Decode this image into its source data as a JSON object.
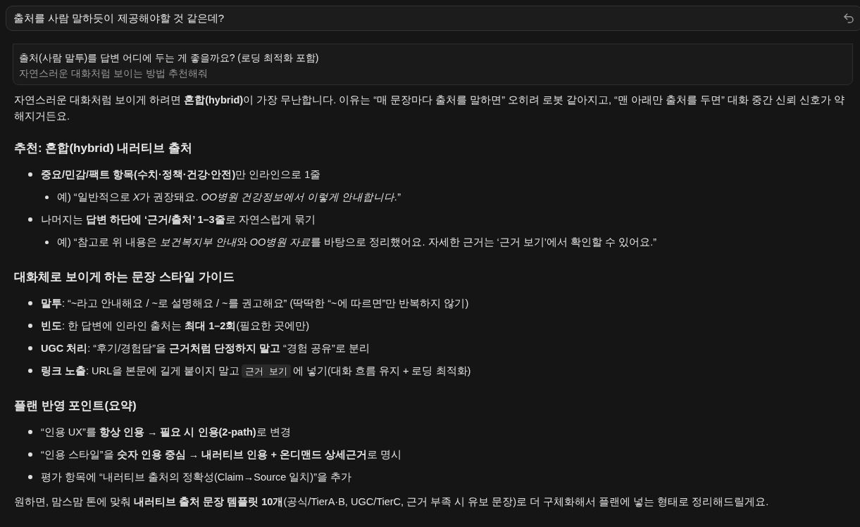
{
  "prompt_field": {
    "value": "출처를 사람 말하듯이 제공해야할 것 같은데?"
  },
  "answer_card": {
    "title": "출처(사람 말투)를 답변 어디에 두는 게 좋을까요? (로딩 최적화 포함)",
    "subtitle": "자연스러운 대화처럼 보이는 방법 추천해줘"
  },
  "intro": "자연스러운 대화처럼 보이게 하려면 **혼합(hybrid)**이 가장 무난합니다. 이유는 “매 문장마다 출처를 말하면” 오히려 로봇 같아지고, “맨 아래만 출처를 두면” 대화 중간 신뢰 신호가 약해지거든요.",
  "sections": [
    {
      "heading": "추천: 혼합(hybrid) 내러티브 출처",
      "items": [
        {
          "text": "**중요/민감/팩트 항목(수치·정책·건강·안전)**만 인라인으로 1줄",
          "children": [
            {
              "segments": [
                {
                  "kind": "text",
                  "text": "예) “일반적으로 "
                },
                {
                  "kind": "italic",
                  "text": "X"
                },
                {
                  "kind": "text",
                  "text": "가 권장돼요. *OO병원 건강정보에서 이렇게 안내합니다.*”"
                }
              ]
            }
          ]
        },
        {
          "text": "나머지는 **답변 하단에 ‘근거/출처’ 1–3줄**로 자연스럽게 묶기",
          "children": [
            {
              "segments": [
                {
                  "kind": "text",
                  "text": "예) “참고로 위 내용은 "
                },
                {
                  "kind": "italic",
                  "text": "보건복지부 안내"
                },
                {
                  "kind": "text",
                  "text": "와 "
                },
                {
                  "kind": "italic",
                  "text": "OO병원 자료"
                },
                {
                  "kind": "text",
                  "text": "를 바탕으로 정리했어요. 자세한 근거는 ‘근거 보기’에서 확인할 수 있어요.”"
                }
              ]
            }
          ]
        }
      ]
    },
    {
      "heading": "대화체로 보이게 하는 문장 스타일 가이드",
      "items": [
        {
          "text": "**말투**: “~라고 안내해요 / ~로 설명해요 / ~를 권고해요” (딱딱한 “~에 따르면”만 반복하지 않기)"
        },
        {
          "text": "**빈도**: 한 답변에 인라인 출처는 **최대 1–2회**(필요한 곳에만)"
        },
        {
          "text": "**UGC 처리**: “후기/경험담”을 **근거처럼 단정하지 말고** “경험 공유”로 분리"
        },
        {
          "segments": [
            {
              "kind": "text",
              "text": "**링크 노출**: URL을 본문에 길게 붙이지 말고"
            },
            {
              "kind": "code",
              "text": "근거 보기"
            },
            {
              "kind": "text",
              "text": "에 넣기(대화 흐름 유지 + 로딩 최적화)"
            }
          ]
        }
      ]
    },
    {
      "heading": "플랜 반영 포인트(요약)",
      "items": [
        {
          "text": "“인용 UX”를 **항상 인용 → 필요 시 인용(2-path)**로 변경"
        },
        {
          "text": "“인용 스타일”을 **숫자 인용 중심 → 내러티브 인용 + 온디맨드 상세근거**로 명시"
        },
        {
          "text": "평가 항목에 “내러티브 출처의 정확성(Claim→Source 일치)”을 추가"
        }
      ]
    }
  ],
  "closing": "원하면, 맘스맘 톤에 맞춰 **내러티브 출처 문장 템플릿 10개**(공식/TierA·B, UGC/TierC, 근거 부족 시 유보 문장)로 더 구체화해서 플랜에 넣는 형태로 정리해드릴게요."
}
